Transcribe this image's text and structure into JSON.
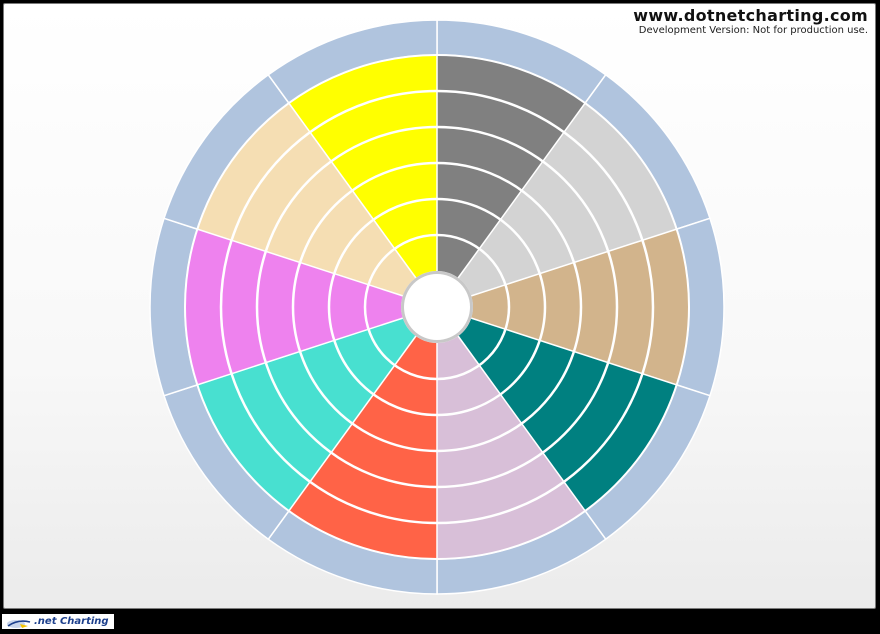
{
  "watermark": {
    "title": "www.dotnetcharting.com",
    "subtitle": "Development Version: Not for production use."
  },
  "footer": {
    "logo_text": ".net Charting"
  },
  "colors": {
    "outer_ring": "#b0c4de",
    "center_fill": "#ffffff",
    "separator": "#ffffff"
  },
  "chart_data": {
    "type": "radar-sectors",
    "rings": 5,
    "series": [
      {
        "color": "#808080"
      },
      {
        "color": "#d3d3d3"
      },
      {
        "color": "#d2b48c"
      },
      {
        "color": "#008080"
      },
      {
        "color": "#d8bfd8"
      },
      {
        "color": "#ff6347"
      },
      {
        "color": "#48e0d0"
      },
      {
        "color": "#ee82ee"
      },
      {
        "color": "#f5deb3"
      },
      {
        "color": "#ffff00"
      }
    ]
  }
}
